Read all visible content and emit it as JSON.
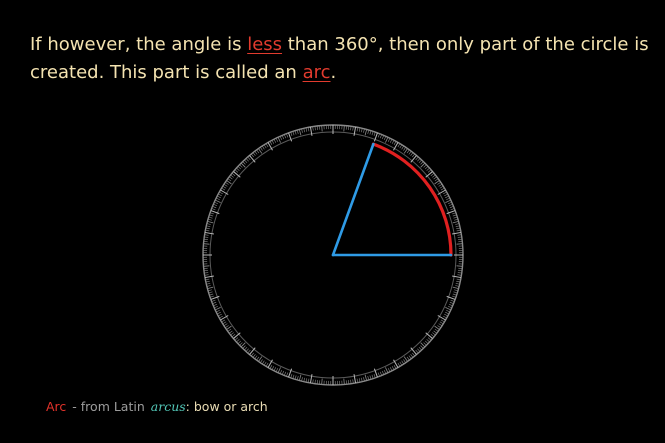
{
  "caption": {
    "part1": "If however, the angle is ",
    "highlight1": "less",
    "part2": " than 360°, then only part of the circle is created. This part is called an ",
    "highlight2": "arc",
    "part3": "."
  },
  "footnote": {
    "term": "Arc",
    "dash_from": "- from Latin",
    "latin_word": "arcus",
    "meaning": ": bow or arch"
  },
  "diagram": {
    "angle_degrees": 70,
    "colors": {
      "radius_lines": "#2f9be6",
      "arc": "#e02020",
      "protractor": "#8a8a8a"
    }
  }
}
